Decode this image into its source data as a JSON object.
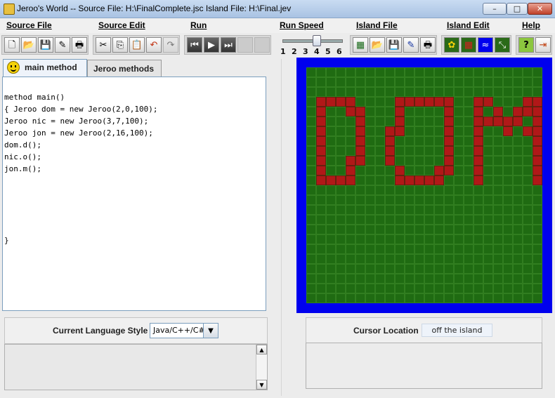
{
  "window": {
    "title": "Jeroo's World -- Source File: H:\\FinalComplete.jsc    Island File: H:\\Final.jev",
    "controls": {
      "minimize": "–",
      "maximize": "□",
      "close": "✕"
    }
  },
  "menu": [
    "Source File",
    "Source Edit",
    "Run",
    "Run Speed",
    "Island File",
    "Island Edit",
    "Help"
  ],
  "toolbar": {
    "file_icons": [
      "new-file-icon",
      "open-folder-icon",
      "save-icon",
      "save-as-icon",
      "print-icon"
    ],
    "edit_icons": [
      "cut-icon",
      "copy-icon",
      "paste-icon",
      "undo-icon",
      "redo-icon"
    ],
    "run_icons": [
      "reset-icon",
      "play-icon",
      "step-icon",
      "pause-icon",
      "stop-icon"
    ],
    "island_file_icons": [
      "new-island-icon",
      "open-island-icon",
      "save-island-icon",
      "save-island-as-icon",
      "print-island-icon"
    ],
    "island_edit_icons": [
      "flower-icon",
      "net-icon",
      "water-icon",
      "clear-island-icon"
    ],
    "help_icons": [
      "help-icon",
      "exit-icon"
    ],
    "speed_ticks": [
      "1",
      "2",
      "3",
      "4",
      "5",
      "6"
    ],
    "speed_value": 4
  },
  "tabs": {
    "main": "main method",
    "jeroo": "Jeroo methods"
  },
  "editor": {
    "code": "method main()\n{ Jeroo dom = new Jeroo(2,0,100);\nJeroo nic = new Jeroo(3,7,100);\nJeroo jon = new Jeroo(2,16,100);\ndom.d();\nnic.o();\njon.m();\n\n\n\n\n\n}"
  },
  "bottom_left": {
    "label": "Current Language Style",
    "language": "Java/C++/C#"
  },
  "bottom_right": {
    "label": "Cursor Location",
    "value": "off the island"
  },
  "island": {
    "colors": {
      "water": "#0000ee",
      "grass": "#1f6b12",
      "net": "#b01818"
    },
    "rows": 24,
    "cols": 24,
    "net_cells": [
      [
        3,
        1
      ],
      [
        3,
        2
      ],
      [
        3,
        3
      ],
      [
        3,
        4
      ],
      [
        4,
        4
      ],
      [
        4,
        5
      ],
      [
        5,
        5
      ],
      [
        6,
        5
      ],
      [
        7,
        5
      ],
      [
        8,
        5
      ],
      [
        9,
        4
      ],
      [
        9,
        5
      ],
      [
        10,
        4
      ],
      [
        11,
        1
      ],
      [
        11,
        2
      ],
      [
        11,
        3
      ],
      [
        11,
        4
      ],
      [
        4,
        1
      ],
      [
        5,
        1
      ],
      [
        6,
        1
      ],
      [
        7,
        1
      ],
      [
        8,
        1
      ],
      [
        9,
        1
      ],
      [
        10,
        1
      ],
      [
        3,
        9
      ],
      [
        3,
        10
      ],
      [
        3,
        11
      ],
      [
        3,
        12
      ],
      [
        3,
        13
      ],
      [
        3,
        14
      ],
      [
        4,
        9
      ],
      [
        5,
        9
      ],
      [
        6,
        8
      ],
      [
        6,
        9
      ],
      [
        7,
        8
      ],
      [
        8,
        8
      ],
      [
        9,
        8
      ],
      [
        10,
        9
      ],
      [
        11,
        9
      ],
      [
        11,
        10
      ],
      [
        11,
        11
      ],
      [
        11,
        12
      ],
      [
        11,
        13
      ],
      [
        4,
        14
      ],
      [
        5,
        14
      ],
      [
        6,
        14
      ],
      [
        7,
        14
      ],
      [
        8,
        14
      ],
      [
        9,
        14
      ],
      [
        10,
        13
      ],
      [
        10,
        14
      ],
      [
        3,
        17
      ],
      [
        3,
        18
      ],
      [
        4,
        17
      ],
      [
        5,
        17
      ],
      [
        6,
        17
      ],
      [
        7,
        17
      ],
      [
        8,
        17
      ],
      [
        9,
        17
      ],
      [
        10,
        17
      ],
      [
        11,
        17
      ],
      [
        4,
        19
      ],
      [
        5,
        18
      ],
      [
        5,
        19
      ],
      [
        5,
        20
      ],
      [
        6,
        20
      ],
      [
        5,
        21
      ],
      [
        4,
        21
      ],
      [
        3,
        22
      ],
      [
        4,
        22
      ],
      [
        3,
        23
      ],
      [
        4,
        23
      ],
      [
        5,
        23
      ],
      [
        6,
        23
      ],
      [
        7,
        23
      ],
      [
        8,
        23
      ],
      [
        9,
        23
      ],
      [
        10,
        23
      ],
      [
        11,
        23
      ],
      [
        6,
        22
      ]
    ]
  }
}
